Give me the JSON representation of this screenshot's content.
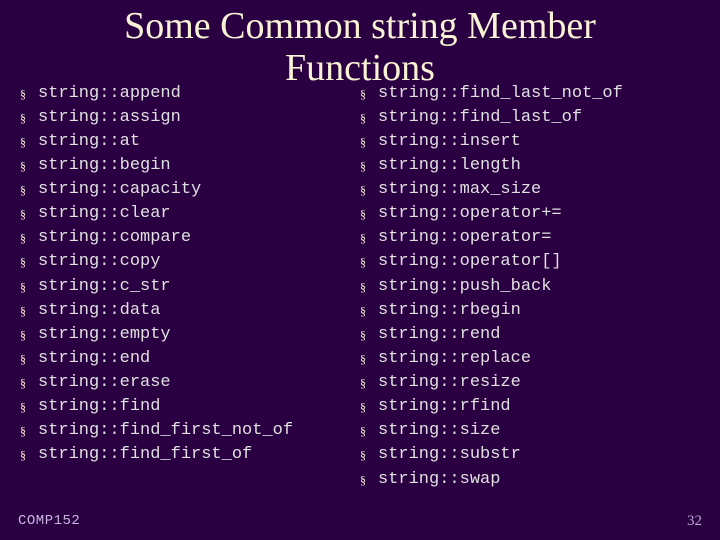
{
  "title_line1": "Some Common string Member",
  "title_line2": "Functions",
  "left_items": [
    "string::append",
    "string::assign",
    "string::at",
    "string::begin",
    "string::capacity",
    "string::clear",
    "string::compare",
    "string::copy",
    "string::c_str",
    "string::data",
    "string::empty",
    "string::end",
    "string::erase",
    "string::find",
    "string::find_first_not_of",
    "string::find_first_of"
  ],
  "right_items": [
    "string::find_last_not_of",
    "string::find_last_of",
    "string::insert",
    "string::length",
    "string::max_size",
    "string::operator+=",
    "string::operator=",
    "string::operator[]",
    "string::push_back",
    "string::rbegin",
    "string::rend",
    "string::replace",
    "string::resize",
    "string::rfind",
    "string::size",
    "string::substr",
    "string::swap"
  ],
  "footer": {
    "course": "COMP152",
    "pagenum": "32"
  },
  "bullet_glyph": "§"
}
